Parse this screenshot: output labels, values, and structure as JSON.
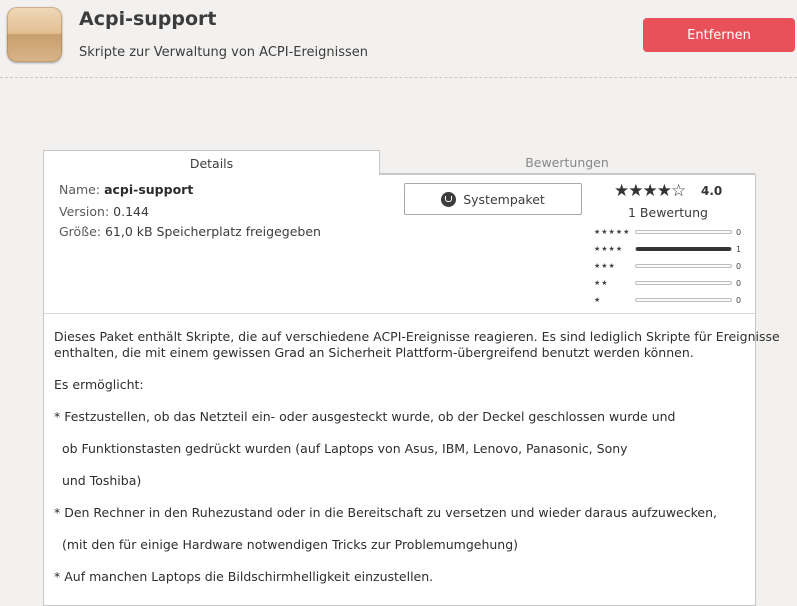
{
  "header": {
    "title": "Acpi-support",
    "subtitle": "Skripte zur Verwaltung von ACPI-Ereignissen",
    "remove_label": "Entfernen",
    "remove_color": "#e8515a",
    "icon": "package-icon"
  },
  "tabs": [
    {
      "label": "Details",
      "active": true
    },
    {
      "label": "Bewertungen",
      "active": false
    }
  ],
  "details": {
    "name_label": "Name:",
    "name_value": "acpi-support",
    "version_label": "Version:",
    "version_value": "0.144",
    "size_label": "Größe:",
    "size_value": "61,0 kB Speicherplatz freigegeben"
  },
  "system_package": {
    "label": "Systempaket",
    "icon": "linux-mint-icon"
  },
  "rating": {
    "stars_display": "★★★★☆",
    "value": 4.0,
    "average": "4.0",
    "count_text": "1 Bewertung",
    "histogram": [
      {
        "stars": "★★★★★",
        "count": 0,
        "count_text": "0",
        "fraction": 0
      },
      {
        "stars": "★★★★",
        "count": 1,
        "count_text": "1",
        "fraction": 1
      },
      {
        "stars": "★★★",
        "count": 0,
        "count_text": "0",
        "fraction": 0
      },
      {
        "stars": "★★",
        "count": 0,
        "count_text": "0",
        "fraction": 0
      },
      {
        "stars": "★",
        "count": 0,
        "count_text": "0",
        "fraction": 0
      }
    ]
  },
  "description": [
    "Dieses Paket enthält Skripte, die auf verschiedene ACPI-Ereignisse reagieren. Es sind lediglich Skripte für Ereignisse",
    "enthalten, die mit einem gewissen Grad an Sicherheit Plattform-übergreifend benutzt werden können.",
    "Es ermöglicht:",
    "* Festzustellen, ob das Netzteil ein- oder ausgesteckt wurde, ob der Deckel geschlossen wurde und",
    "  ob Funktionstasten gedrückt wurden (auf Laptops von Asus, IBM, Lenovo, Panasonic, Sony",
    "  und Toshiba)",
    "* Den Rechner in den Ruhezustand oder in die Bereitschaft zu versetzen und wieder daraus aufzuwecken,",
    "  (mit den für einige Hardware notwendigen Tricks zur Problemumgehung)",
    "* Auf manchen Laptops die Bildschirmhelligkeit einzustellen."
  ]
}
